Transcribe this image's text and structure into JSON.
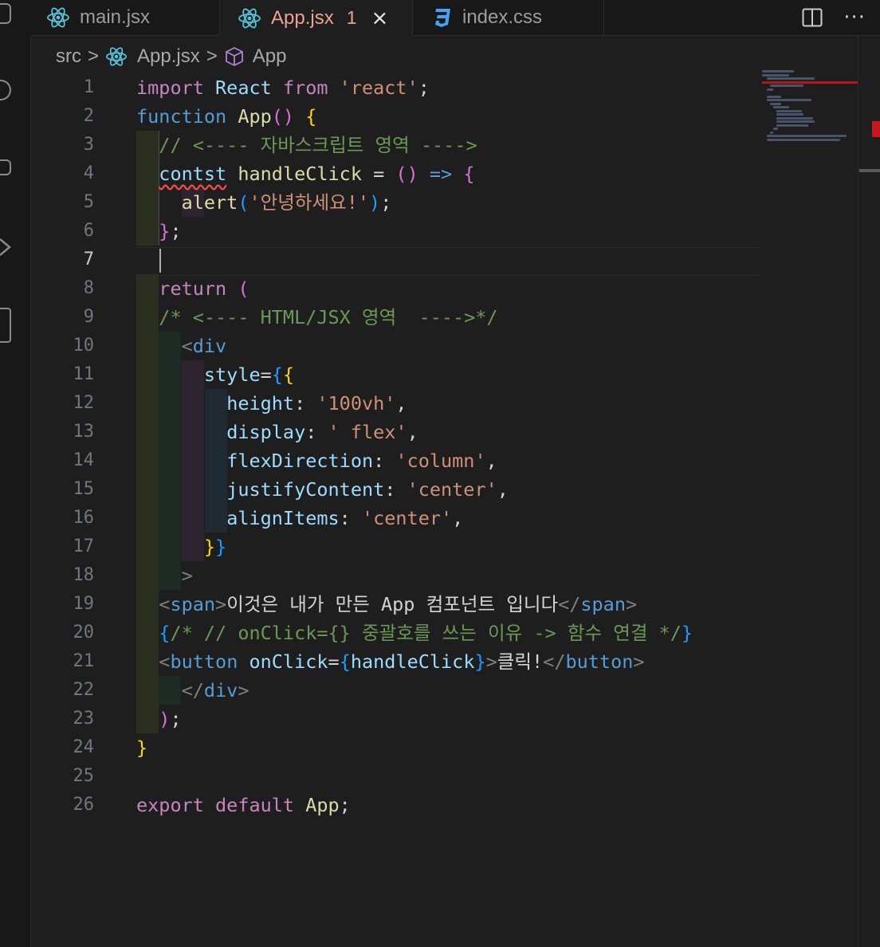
{
  "tabs": [
    {
      "label": "main.jsx",
      "icon": "react-icon",
      "active": false
    },
    {
      "label": "App.jsx",
      "icon": "react-icon",
      "active": true,
      "badge": "1",
      "close": "×"
    },
    {
      "label": "index.css",
      "icon": "css-icon",
      "active": false
    }
  ],
  "tab_actions": {
    "more": "···"
  },
  "breadcrumb": {
    "folder": "src",
    "file": "App.jsx",
    "symbol": "App",
    "sep": ">"
  },
  "editor": {
    "current_line": 7,
    "line_numbers": [
      "1",
      "2",
      "3",
      "4",
      "5",
      "6",
      "7",
      "8",
      "9",
      "10",
      "11",
      "12",
      "13",
      "14",
      "15",
      "16",
      "17",
      "18",
      "19",
      "20",
      "21",
      "22",
      "23",
      "24",
      "25",
      "26"
    ],
    "lines": {
      "l1": {
        "a": "import",
        "b": " React ",
        "c": "from",
        "d": " 'react'",
        "e": ";"
      },
      "l2": {
        "a": "function",
        "b": " App",
        "c": "()",
        "d": " {"
      },
      "l3": {
        "a": "// <---- 자바스크립트 영역 ---->"
      },
      "l4": {
        "a": "contst",
        "b": " handleClick",
        "c": " = ",
        "d": "()",
        "e": " => ",
        "f": "{"
      },
      "l5": {
        "a": "alert",
        "b": "(",
        "c": "'안녕하세요!'",
        "d": ")",
        "e": ";"
      },
      "l6": {
        "a": "}",
        "b": ";"
      },
      "l8": {
        "a": "return",
        "b": " ("
      },
      "l9": {
        "a": "/* <---- HTML/JSX 영역  ---->*/"
      },
      "l10": {
        "a": "<",
        "b": "div"
      },
      "l11": {
        "a": "style",
        "b": "=",
        "c": "{",
        "d": "{"
      },
      "l12": {
        "a": "height",
        "b": ": ",
        "c": "'100vh'",
        "d": ","
      },
      "l13": {
        "a": "display",
        "b": ": ",
        "c": "' flex'",
        "d": ","
      },
      "l14": {
        "a": "flexDirection",
        "b": ": ",
        "c": "'column'",
        "d": ","
      },
      "l15": {
        "a": "justifyContent",
        "b": ": ",
        "c": "'center'",
        "d": ","
      },
      "l16": {
        "a": "alignItems",
        "b": ": ",
        "c": "'center'",
        "d": ","
      },
      "l17": {
        "a": "}",
        "b": "}"
      },
      "l18": {
        "a": ">"
      },
      "l19": {
        "a": "<",
        "b": "span",
        "c": ">",
        "d": "이것은 내가 만든 App 컴포넌트 입니다",
        "e": "</",
        "f": "span",
        "g": ">"
      },
      "l20": {
        "a": "{",
        "b": "/* // onClick={} 중괄호를 쓰는 이유 -> 함수 연결 */",
        "c": "}"
      },
      "l21": {
        "a": "<",
        "b": "button",
        "c": " onClick",
        "d": "=",
        "e": "{",
        "f": "handleClick",
        "g": "}",
        "h": ">",
        "i": "클릭!",
        "j": "</",
        "k": "button",
        "l": ">"
      },
      "l22": {
        "a": "</",
        "b": "div",
        "c": ">"
      },
      "l23": {
        "a": ")",
        "b": ";"
      },
      "l24": {
        "a": "}"
      },
      "l26": {
        "a": "export",
        "b": " default",
        "c": " App",
        "d": ";"
      }
    }
  },
  "colors": {
    "accent_tab": "#f0a18e",
    "error": "#c4161c",
    "react": "#58c4dc",
    "css": "#42a5f5"
  }
}
